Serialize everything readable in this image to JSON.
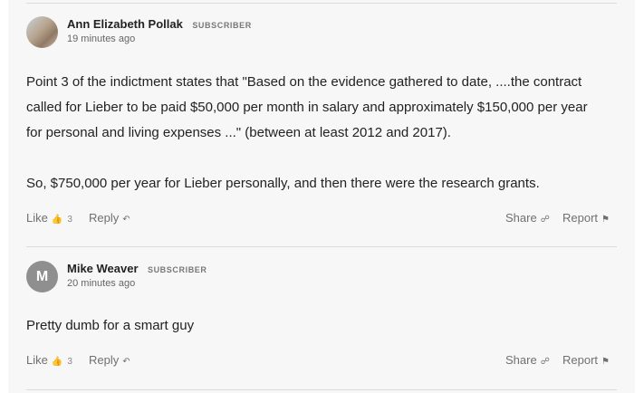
{
  "comments": [
    {
      "author": "Ann Elizabeth Pollak",
      "badge": "SUBSCRIBER",
      "time": "19 minutes ago",
      "paragraphs": [
        "Point 3 of the indictment states that \"Based on the evidence gathered to date, ....the contract",
        "called for Lieber to be paid $50,000 per month in salary and approximately $150,000 per year",
        "for personal and living expenses ...\" (between at least 2012 and 2017).",
        "So, $750,000 per year for Lieber personally, and then there were the research grants."
      ],
      "like_label": "Like",
      "like_count": "3",
      "reply_label": "Reply",
      "share_label": "Share",
      "report_label": "Report"
    },
    {
      "author": "Mike Weaver",
      "badge": "SUBSCRIBER",
      "avatar_letter": "M",
      "time": "20 minutes ago",
      "paragraphs": [
        "Pretty dumb for a smart guy"
      ],
      "like_label": "Like",
      "like_count": "3",
      "reply_label": "Reply",
      "share_label": "Share",
      "report_label": "Report"
    }
  ]
}
